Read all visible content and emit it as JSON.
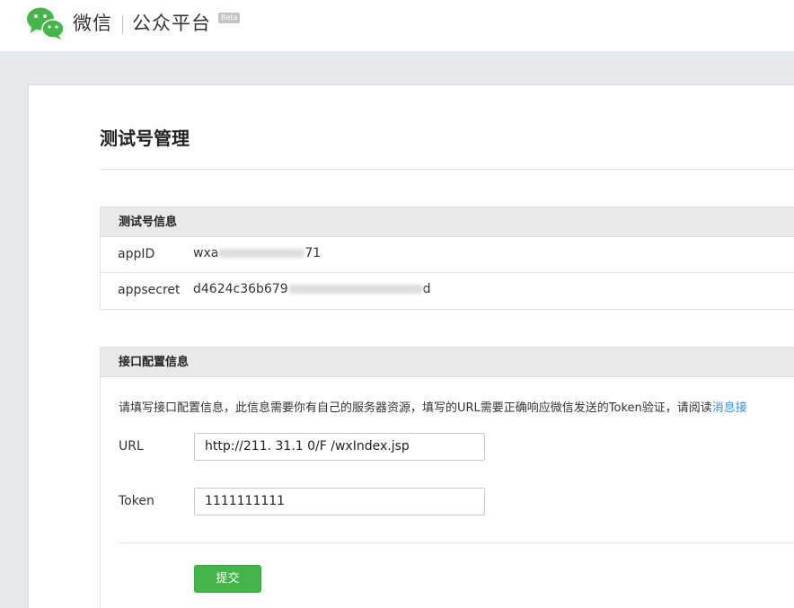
{
  "header": {
    "logo_icon": "wechat-logo-icon",
    "brand": "微信",
    "platform": "公众平台",
    "badge": "Beta"
  },
  "page": {
    "title": "测试号管理"
  },
  "test_account": {
    "heading": "测试号信息",
    "appid_label": "appID",
    "appid_prefix": "wxa",
    "appid_suffix": "71",
    "appsecret_label": "appsecret",
    "appsecret_prefix": "d4624c36b679",
    "appsecret_suffix": "d"
  },
  "interface_config": {
    "heading": "接口配置信息",
    "hint": "请填写接口配置信息，此信息需要你有自己的服务器资源，填写的URL需要正确响应微信发送的Token验证，请阅读",
    "hint_link": "消息接",
    "url_label": "URL",
    "url_value": "http://211.  31.1 0/F   /wxIndex.jsp",
    "token_label": "Token",
    "token_value": "1111111111",
    "submit_label": "提交"
  },
  "colors": {
    "accent_green": "#44b549",
    "link_blue": "#3a8ee6",
    "page_bg": "#e7e8eb"
  }
}
